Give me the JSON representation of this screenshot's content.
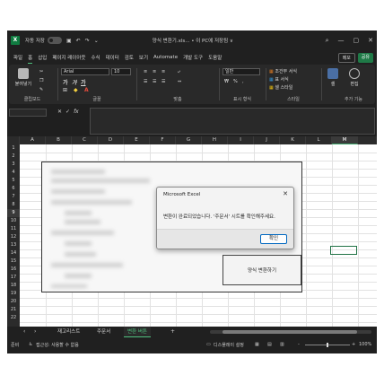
{
  "titlebar": {
    "autosave": "자동 저장",
    "doc_title": "양식 변환기.xls... • 이 PC에 저장됨 ∨",
    "minimize": "—",
    "maximize": "▢",
    "close": "✕"
  },
  "menu": {
    "tabs": [
      "파일",
      "홈",
      "삽입",
      "페이지 레이아웃",
      "수식",
      "데이터",
      "검토",
      "보기",
      "Automate",
      "개발 도구",
      "도움말"
    ],
    "memo": "메모",
    "share": "공유"
  },
  "ribbon": {
    "paste": "붙여넣기",
    "clipboard_label": "클립보드",
    "font_name": "Arial",
    "font_size": "10",
    "font_label": "글꼴",
    "align_label": "맞춤",
    "number_format": "일반",
    "number_label": "표시 형식",
    "conditional": "조건부 서식",
    "table_format": "표 서식",
    "cell_style": "셀 스타일",
    "style_label": "스타일",
    "cells": "셀",
    "editing": "편집",
    "addins_label": "추가 기능"
  },
  "formula_bar": {
    "name_box": "",
    "fx": "fx",
    "formula": ""
  },
  "grid": {
    "columns": [
      "A",
      "B",
      "C",
      "D",
      "E",
      "F",
      "G",
      "H",
      "I",
      "J",
      "K",
      "L",
      "M"
    ],
    "rows": [
      "1",
      "2",
      "3",
      "4",
      "5",
      "6",
      "7",
      "8",
      "9",
      "10",
      "11",
      "12",
      "13",
      "14",
      "15",
      "16",
      "17",
      "18",
      "19",
      "20",
      "21",
      "22"
    ],
    "selected_column": "M",
    "selected_row": "9",
    "convert_button": "양식 변환하기"
  },
  "dialog": {
    "title": "Microsoft Excel",
    "message": "변환이 완료되었습니다. '주문서' 시트를 확인해주세요.",
    "ok": "확인",
    "close": "✕"
  },
  "sheets": {
    "tabs": [
      "재고리스트",
      "주문서",
      "변환 버튼"
    ],
    "active": "변환 버튼",
    "add": "+"
  },
  "status": {
    "ready": "준비",
    "accessibility": "접근성: 사용할 수 없음",
    "display": "디스플레이 설정",
    "zoom_minus": "-",
    "zoom_plus": "+",
    "zoom": "100%"
  },
  "colors": {
    "excel_green": "#107c41",
    "accent": "#4fc17f",
    "dialog_ok_border": "#0067c0"
  }
}
